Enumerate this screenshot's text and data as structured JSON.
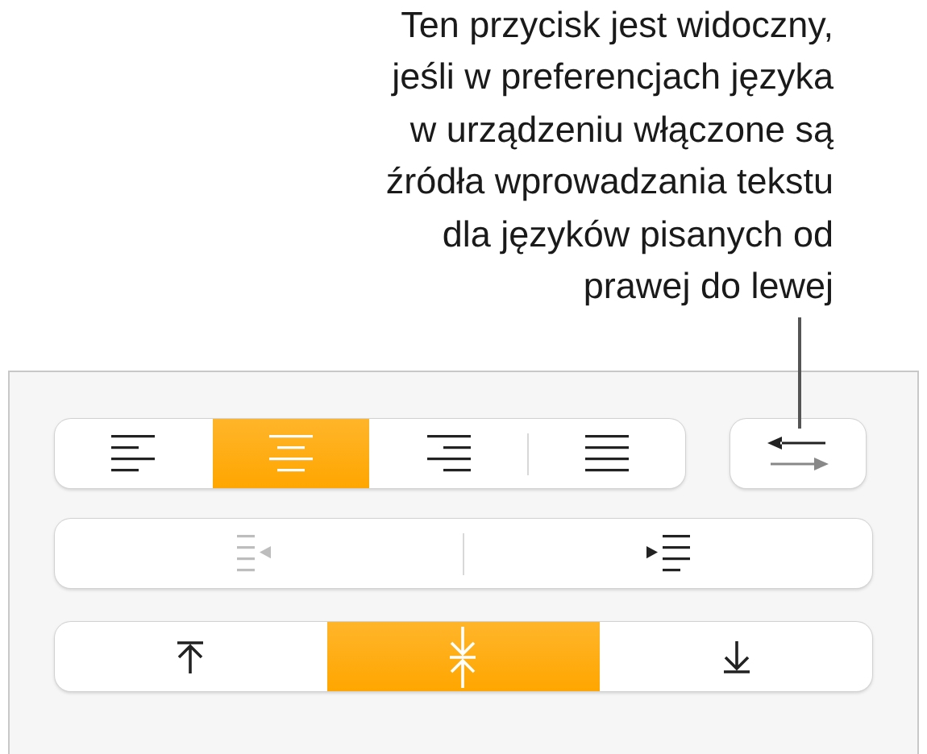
{
  "callout": {
    "lines": [
      "Ten przycisk jest widoczny,",
      "jeśli w preferencjach języka",
      "w urządzeniu włączone są",
      "źródła wprowadzania tekstu",
      "dla języków pisanych od",
      "prawej do lewej"
    ]
  },
  "alignment": [
    {
      "kind": "left",
      "selected": false
    },
    {
      "kind": "center",
      "selected": true
    },
    {
      "kind": "right",
      "selected": false
    },
    {
      "kind": "justify",
      "selected": false
    }
  ],
  "direction_button": {
    "kind": "direction"
  },
  "indent": [
    {
      "kind": "decrease",
      "disabled": true
    },
    {
      "kind": "increase",
      "disabled": false
    }
  ],
  "vertical": [
    {
      "kind": "top",
      "selected": false
    },
    {
      "kind": "middle",
      "selected": true
    },
    {
      "kind": "bottom",
      "selected": false
    }
  ]
}
